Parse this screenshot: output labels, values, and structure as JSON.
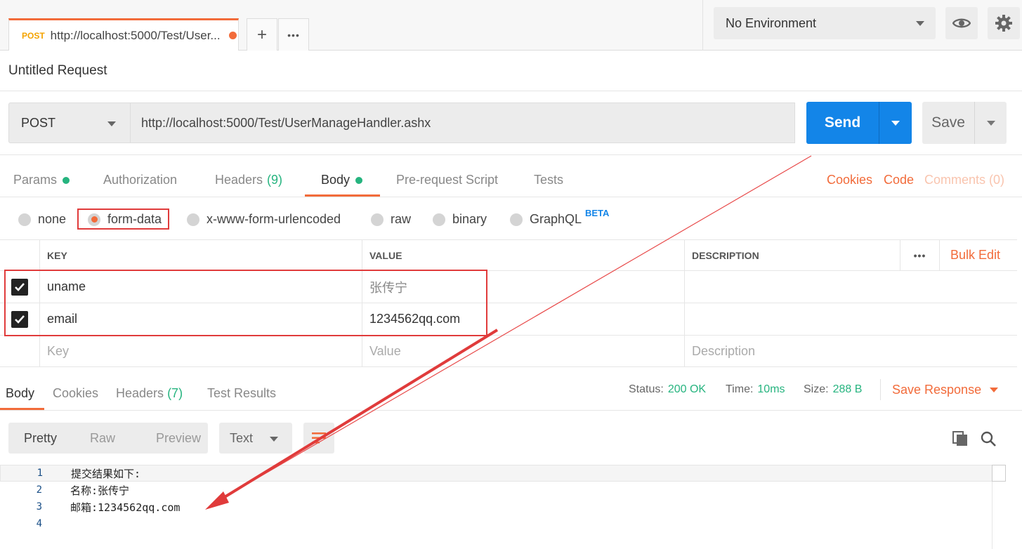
{
  "request_tab": {
    "method": "POST",
    "url": "http://localhost:5000/Test/User..."
  },
  "tab_actions": {
    "add": "+",
    "more": "•••"
  },
  "environment": {
    "selected": "No Environment"
  },
  "request": {
    "title": "Untitled Request",
    "method": "POST",
    "url": "http://localhost:5000/Test/UserManageHandler.ashx",
    "send_label": "Send",
    "save_label": "Save"
  },
  "request_tabs": {
    "params": "Params",
    "authorization": "Authorization",
    "headers": "Headers",
    "headers_count": "(9)",
    "body": "Body",
    "prerequest": "Pre-request Script",
    "tests": "Tests",
    "cookies": "Cookies",
    "code": "Code",
    "comments": "Comments (0)"
  },
  "body_types": {
    "none": "none",
    "form_data": "form-data",
    "urlencoded": "x-www-form-urlencoded",
    "raw": "raw",
    "binary": "binary",
    "graphql": "GraphQL",
    "beta": "BETA"
  },
  "kv_table": {
    "headers": {
      "key": "KEY",
      "value": "VALUE",
      "description": "DESCRIPTION",
      "bulk_edit": "Bulk Edit",
      "more": "•••"
    },
    "rows": [
      {
        "key": "uname",
        "value": "张传宁",
        "description": ""
      },
      {
        "key": "email",
        "value": "1234562qq.com",
        "description": ""
      }
    ],
    "placeholder": {
      "key": "Key",
      "value": "Value",
      "description": "Description"
    }
  },
  "response_tabs": {
    "body": "Body",
    "cookies": "Cookies",
    "headers": "Headers",
    "headers_count": "(7)",
    "test_results": "Test Results"
  },
  "response_status": {
    "status_label": "Status:",
    "status_value": "200 OK",
    "time_label": "Time:",
    "time_value": "10ms",
    "size_label": "Size:",
    "size_value": "288 B",
    "save_response": "Save Response"
  },
  "response_view": {
    "pretty": "Pretty",
    "raw": "Raw",
    "preview": "Preview",
    "format": "Text"
  },
  "response_body": [
    {
      "n": "1",
      "text": "提交结果如下:"
    },
    {
      "n": "2",
      "text": "名称:张传宁"
    },
    {
      "n": "3",
      "text": "邮箱:1234562qq.com"
    },
    {
      "n": "4",
      "text": ""
    }
  ],
  "colors": {
    "accent": "#f26b3a",
    "primary": "#1385e8",
    "success": "#26b47f",
    "annotation": "#e03b3b"
  }
}
